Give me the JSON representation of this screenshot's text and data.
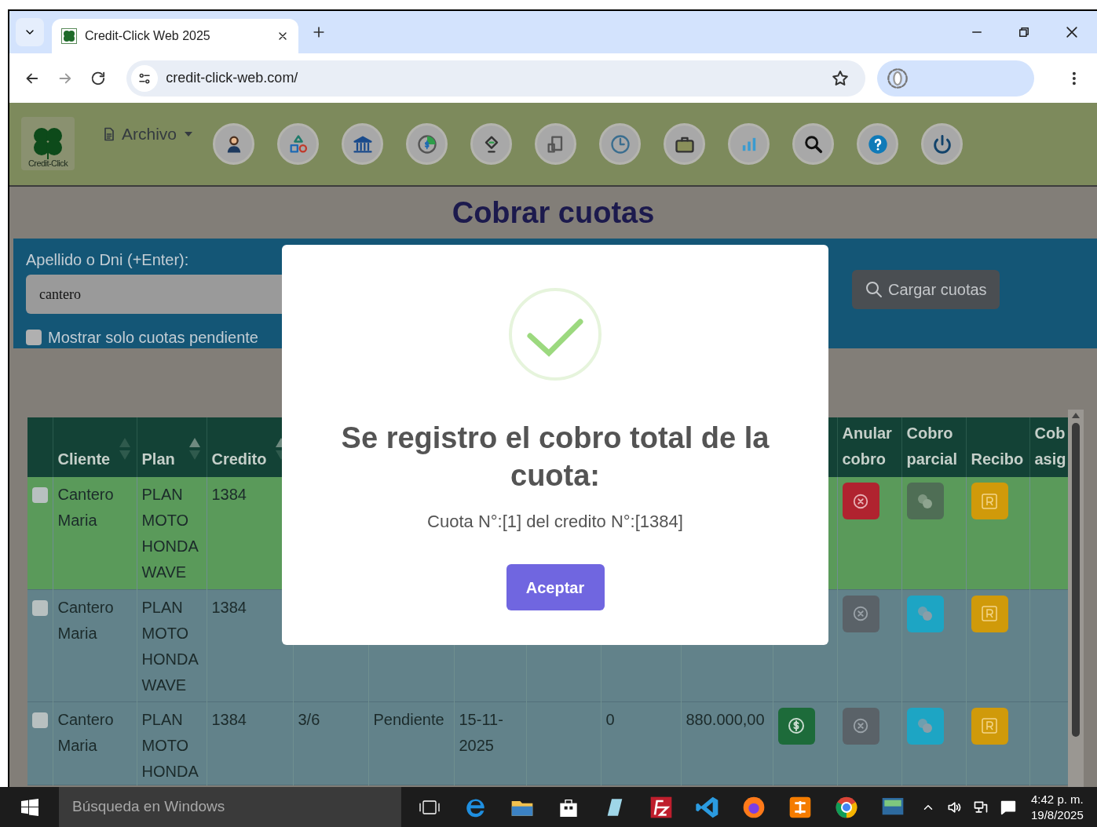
{
  "browser": {
    "tab_title": "Credit-Click Web 2025",
    "url": "credit-click-web.com/"
  },
  "app": {
    "logo_text": "Credit-Click",
    "menu": "Archivo"
  },
  "page_title": "Cobrar cuotas",
  "search": {
    "label": "Apellido o Dni (+Enter):",
    "value": "cantero",
    "checkbox": {
      "label": "Mostrar solo cuotas pendiente",
      "checked": false
    },
    "button": "Cargar cuotas"
  },
  "table": {
    "columns": [
      {
        "label": "Cliente",
        "sorted_ascending": false
      },
      {
        "label": "Plan",
        "sorted_ascending": true
      },
      {
        "label": "Credito",
        "sorted_ascending": true
      },
      {},
      {},
      {},
      {},
      {},
      {},
      {},
      {
        "label": "Anular cobro"
      },
      {
        "label": "Cobro parcial"
      },
      {
        "label": "Recibo"
      },
      {
        "label": "Cob asig"
      }
    ],
    "rows": [
      {
        "checked": false,
        "paid": true,
        "cells": [
          "Cantero Maria",
          "PLAN MOTO HONDA WAVE",
          "1384"
        ]
      },
      {
        "checked": false,
        "paid": false,
        "cells": [
          "Cantero Maria",
          "PLAN MOTO HONDA WAVE",
          "1384"
        ]
      },
      {
        "checked": false,
        "paid": false,
        "can_pay": true,
        "cells": [
          "Cantero Maria",
          "PLAN MOTO HONDA",
          "1384",
          "3/6",
          "Pendiente",
          "15-11-2025",
          "",
          "0",
          "880.000,00"
        ]
      }
    ]
  },
  "modal": {
    "title": "Se registro el cobro total de la cuota:",
    "message": "Cuota N°:[1] del credito N°:[1384]",
    "button": "Aceptar"
  },
  "taskbar": {
    "search_placeholder": "Búsqueda en Windows",
    "time": "4:42 p. m.",
    "date": "19/8/2025"
  }
}
